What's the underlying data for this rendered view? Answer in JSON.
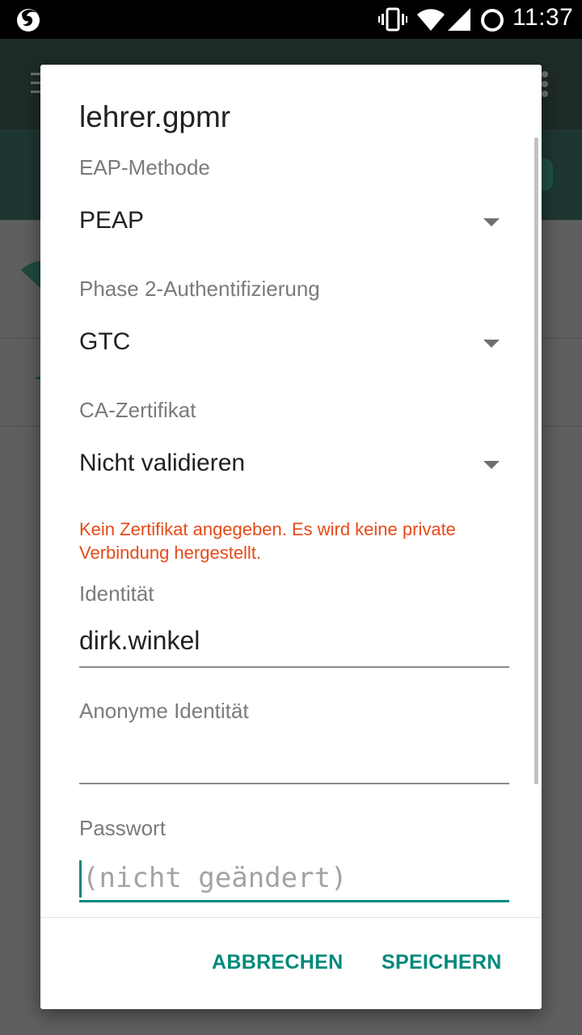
{
  "status_bar": {
    "time": "11:37",
    "icons": [
      "firefox-notification-icon",
      "vibrate-icon",
      "wifi-icon",
      "cell-signal-icon",
      "battery-icon"
    ]
  },
  "dialog": {
    "title": "lehrer.gpmr",
    "eap_method": {
      "label": "EAP-Methode",
      "value": "PEAP"
    },
    "phase2_auth": {
      "label": "Phase 2-Authentifizierung",
      "value": "GTC"
    },
    "ca_certificate": {
      "label": "CA-Zertifikat",
      "value": "Nicht validieren"
    },
    "warning": "Kein Zertifikat angegeben. Es wird keine private Verbindung hergestellt.",
    "identity": {
      "label": "Identität",
      "value": "dirk.winkel"
    },
    "anonymous_identity": {
      "label": "Anonyme Identität",
      "value": ""
    },
    "password": {
      "label": "Passwort",
      "placeholder": "(nicht geändert)",
      "value": ""
    },
    "buttons": {
      "cancel": "ABBRECHEN",
      "save": "SPEICHERN"
    }
  },
  "colors": {
    "accent": "#00897b",
    "warning": "#e64a19",
    "scrim": "#5f5f5f"
  }
}
